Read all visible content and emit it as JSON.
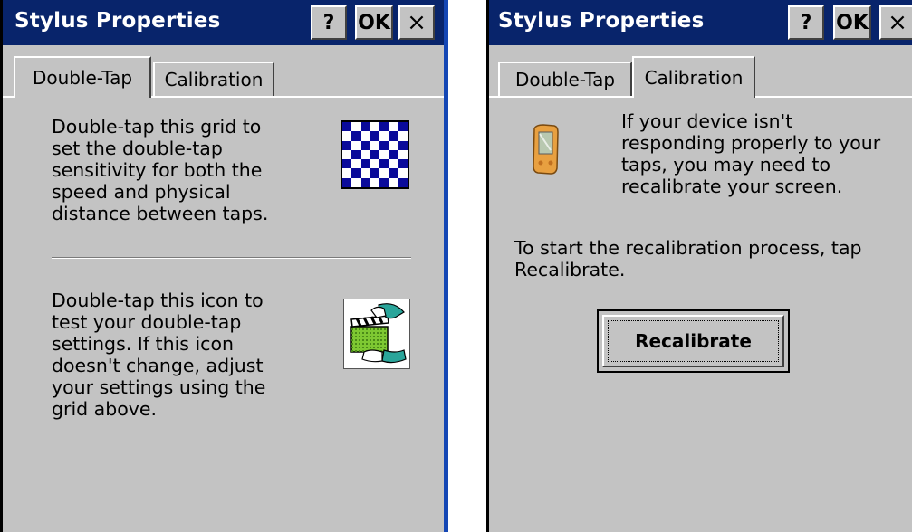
{
  "dialogs": {
    "left": {
      "title": "Stylus Properties",
      "buttons": {
        "help": "?",
        "ok": "OK",
        "close": "×"
      },
      "tabs": [
        {
          "label": "Double-Tap",
          "active": true
        },
        {
          "label": "Calibration",
          "active": false
        }
      ],
      "section1_text": "Double-tap this grid to\nset the double-tap\nsensitivity for both the\nspeed and physical\ndistance between taps.",
      "section2_text": "Double-tap this icon to\ntest your double-tap\nsettings. If this icon\ndoesn't change, adjust\nyour settings using the\ngrid above.",
      "icons": {
        "grid": "checkerboard-grid-icon",
        "test": "clapperboard-hands-icon"
      }
    },
    "right": {
      "title": "Stylus Properties",
      "buttons": {
        "help": "?",
        "ok": "OK",
        "close": "×"
      },
      "tabs": [
        {
          "label": "Double-Tap",
          "active": false
        },
        {
          "label": "Calibration",
          "active": true
        }
      ],
      "intro_text": "If your device isn't\nresponding properly to your\ntaps, you may need to\nrecalibrate your screen.",
      "instruction_text": "To start the recalibration process, tap\nRecalibrate.",
      "recalibrate_label": "Recalibrate",
      "icons": {
        "device": "handheld-device-icon"
      }
    }
  },
  "colors": {
    "titlebar": "#08246b",
    "dialog_bg": "#c3c3c3",
    "grid_dark": "#0a0a9a"
  }
}
